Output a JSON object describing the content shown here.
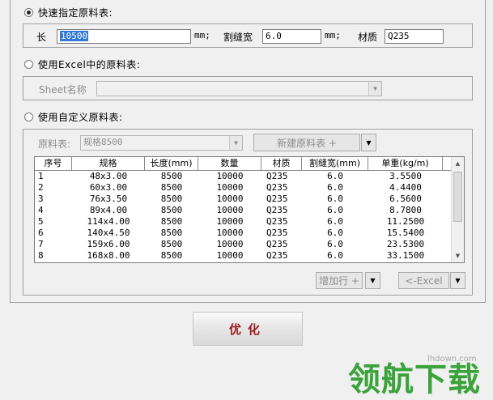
{
  "quick": {
    "label": "快速指定原料表:",
    "length_label": "长",
    "length_value": "10500",
    "unit_mm1": "mm;",
    "kerf_label": "割缝宽",
    "kerf_value": "6.0",
    "unit_mm2": "mm;",
    "material_label": "材质",
    "material_value": "Q235"
  },
  "excel": {
    "label": "使用Excel中的原料表:",
    "sheet_label": "Sheet名称",
    "sheet_value": ""
  },
  "custom": {
    "label": "使用自定义原料表:",
    "material_table_label": "原料表:",
    "material_table_value": "规格8500",
    "new_table_button": "新建原料表 +",
    "add_row_button": "增加行 +",
    "excel_button": "<-Excel"
  },
  "table": {
    "headers": [
      "序号",
      "规格",
      "长度(mm)",
      "数量",
      "材质",
      "割缝宽(mm)",
      "单重(kg/m)"
    ],
    "rows": [
      [
        "1",
        "48x3.00",
        "8500",
        "10000",
        "Q235",
        "6.0",
        "3.5500"
      ],
      [
        "2",
        "60x3.00",
        "8500",
        "10000",
        "Q235",
        "6.0",
        "4.4400"
      ],
      [
        "3",
        "76x3.50",
        "8500",
        "10000",
        "Q235",
        "6.0",
        "6.5600"
      ],
      [
        "4",
        "89x4.00",
        "8500",
        "10000",
        "Q235",
        "6.0",
        "8.7800"
      ],
      [
        "5",
        "114x4.00",
        "8500",
        "10000",
        "Q235",
        "6.0",
        "11.2500"
      ],
      [
        "6",
        "140x4.50",
        "8500",
        "10000",
        "Q235",
        "6.0",
        "15.5400"
      ],
      [
        "7",
        "159x6.00",
        "8500",
        "10000",
        "Q235",
        "6.0",
        "23.5300"
      ],
      [
        "8",
        "168x8.00",
        "8500",
        "10000",
        "Q235",
        "6.0",
        "33.1500"
      ]
    ]
  },
  "optimize_button": "优化",
  "watermark": {
    "text": "领航下载",
    "url": "lhdown.com"
  }
}
